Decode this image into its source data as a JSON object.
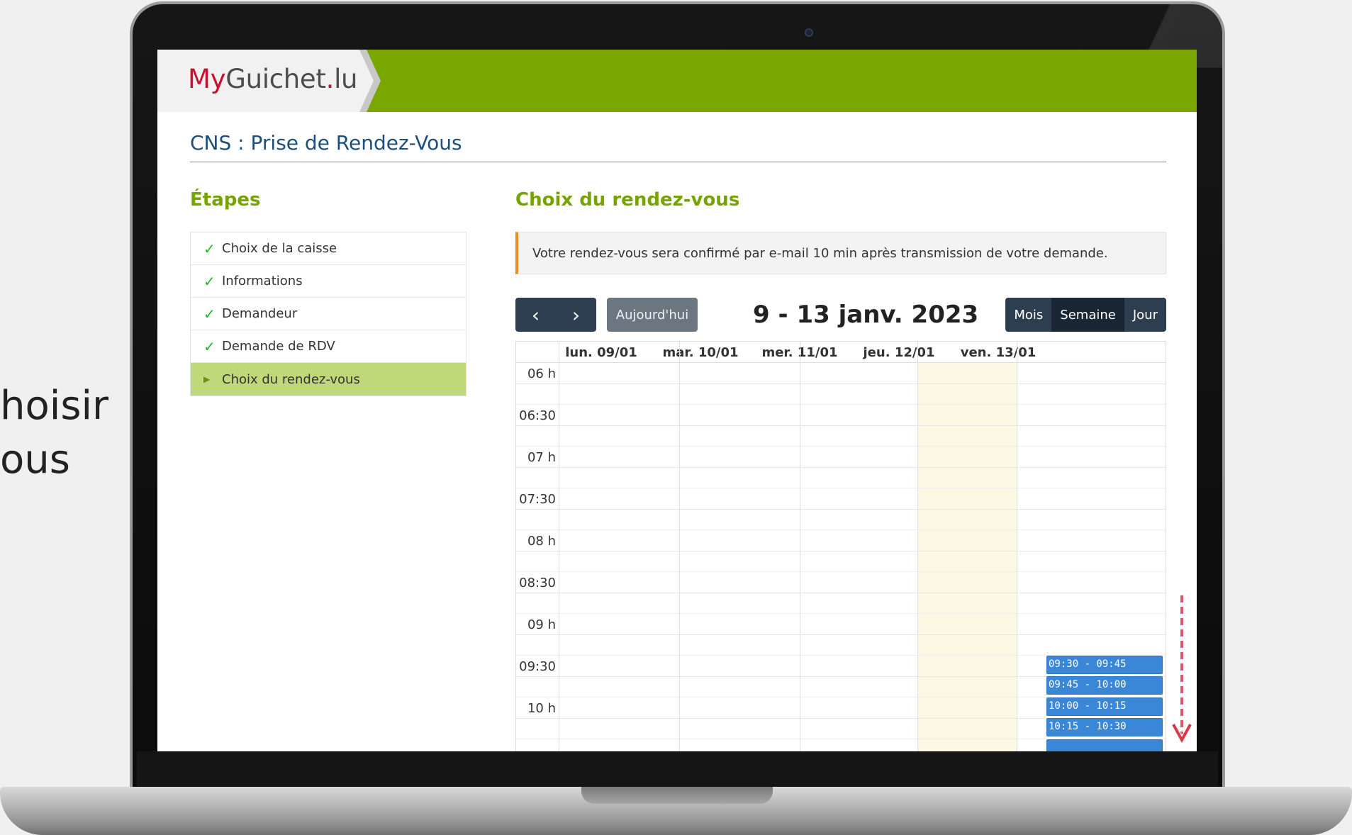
{
  "caption": {
    "line1": "hoisir",
    "line2": "ous"
  },
  "app": {
    "logo_my": "My",
    "logo_name": "Guichet",
    "logo_dot": ".",
    "logo_tld": "lu",
    "page_title": "CNS : Prise de Rendez-Vous"
  },
  "steps": {
    "heading": "Étapes",
    "items": [
      {
        "label": "Choix de la caisse",
        "done": true
      },
      {
        "label": "Informations",
        "done": true
      },
      {
        "label": "Demandeur",
        "done": true
      },
      {
        "label": "Demande de RDV",
        "done": true
      },
      {
        "label": "Choix du rendez-vous",
        "active": true
      }
    ]
  },
  "main": {
    "heading": "Choix du rendez-vous",
    "notice": "Votre rendez-vous sera confirmé par e-mail 10 min après transmission de votre demande."
  },
  "toolbar": {
    "prev": "‹",
    "next": "›",
    "today": "Aujourd'hui",
    "range": "9 - 13 janv. 2023",
    "views": [
      "Mois",
      "Semaine",
      "Jour"
    ],
    "selected_view": "Semaine"
  },
  "calendar": {
    "days": [
      "lun. 09/01",
      "mar. 10/01",
      "mer. 11/01",
      "jeu. 12/01",
      "ven. 13/01"
    ],
    "today_day": "jeu. 12/01",
    "times": [
      "06 h",
      "06:30",
      "07 h",
      "07:30",
      "08 h",
      "08:30",
      "09 h",
      "09:30",
      "10 h"
    ],
    "events": [
      "09:30 - 09:45",
      "09:45 - 10:00",
      "10:00 - 10:15",
      "10:15 - 10:30"
    ]
  },
  "colors": {
    "brand_green": "#79a600",
    "nav_dark": "#2c3e50",
    "event_blue": "#3a87d8",
    "today_bg": "#fcf8e3",
    "notice_accent": "#f08a1a"
  }
}
